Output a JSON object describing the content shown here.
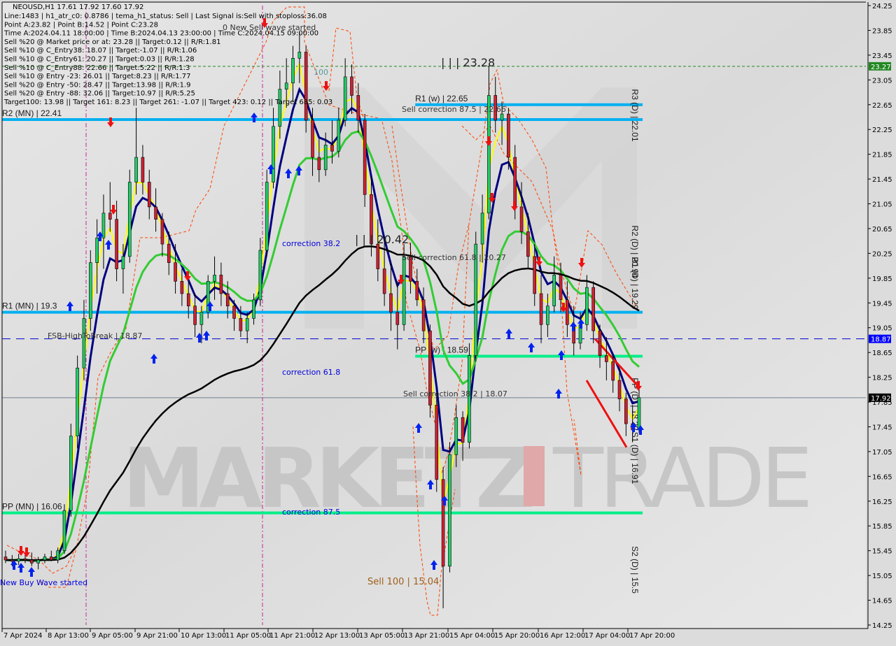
{
  "window": {
    "symbol_header": "NEOUSD,H1  17.61 17.92 17.60 17.92"
  },
  "info_lines": [
    "Line:1483 | h1_atr_c0: 0.8786 | tema_h1_status: Sell | Last Signal is:Sell with stoploss:36.08",
    "Point A:23.82 | Point B:14.52 | Point C:23.28",
    "Time A:2024.04.11 18:00:00 | Time B:2024.04.13 23:00:00 | Time C:2024.04.15 09:00:00",
    "Sell %20 @ Market price or at: 23.28 || Target:0.12 || R/R:1.81",
    "Sell %10 @ C_Entry38: 18.07 || Target:-1.07 || R/R:1.06",
    "Sell %10 @ C_Entry61: 20.27 || Target:0.03 || R/R:1.28",
    "Sell %10 @ C_Entry88: 22.66 || Target:5.22 || R/R:1.3",
    "Sell %10 @ Entry -23: 26.01 || Target:8.23 || R/R:1.77",
    "Sell %20 @ Entry -50: 28.47 || Target:13.98 || R/R:1.9",
    "Sell %20 @ Entry -88: 32.06 || Target:10.97 || R/R:5.25",
    "Target100: 13.98 || Target 161: 8.23 || Target 261: -1.07 || Target 423: 0.12 || Target 685: 0.03"
  ],
  "watermark": {
    "left": "MARKETZ",
    "right": "TRADE"
  },
  "colors": {
    "bull": "#22cc66",
    "bear": "#cc2233",
    "pivot_cyan": "#00b0f0",
    "pivot_green": "#00ee88",
    "ema_yellow": "#ffff00",
    "ema_navy": "#000080",
    "ema_green": "#33cc33",
    "ema_black": "#000000",
    "envelope": "#ff4400",
    "price_tag_green": "#228822",
    "price_tag_blue": "#0000ff",
    "price_tag_black": "#000000"
  },
  "chart_data": {
    "type": "candlestick",
    "title": "NEOUSD,H1",
    "ylim": [
      14.25,
      24.25
    ],
    "y_ticks": [
      "24.25",
      "23.85",
      "23.45",
      "23.05",
      "22.65",
      "22.25",
      "21.85",
      "21.45",
      "21.05",
      "20.65",
      "20.25",
      "19.85",
      "19.45",
      "19.05",
      "18.65",
      "18.25",
      "17.85",
      "17.45",
      "17.05",
      "16.65",
      "16.25",
      "15.85",
      "15.45",
      "15.05",
      "14.65",
      "14.25"
    ],
    "x_ticks": [
      "7 Apr 2024",
      "8 Apr 13:00",
      "9 Apr 05:00",
      "9 Apr 21:00",
      "10 Apr 13:00",
      "11 Apr 05:00",
      "11 Apr 21:00",
      "12 Apr 13:00",
      "13 Apr 05:00",
      "13 Apr 21:00",
      "15 Apr 04:00",
      "15 Apr 20:00",
      "16 Apr 12:00",
      "17 Apr 04:00",
      "17 Apr 20:00"
    ],
    "price_tags": [
      {
        "value": "23.27",
        "price": 23.27,
        "style": "green"
      },
      {
        "value": "18.87",
        "price": 18.87,
        "style": "blue"
      },
      {
        "value": "17.92",
        "price": 17.92,
        "style": "black"
      }
    ],
    "levels": [
      {
        "label": "R2 (MN) | 22.41",
        "price": 22.41,
        "color": "cyan",
        "x_start": 0.0,
        "x_end": 1.0
      },
      {
        "label": "R1 (MN) | 19.3",
        "price": 19.3,
        "color": "cyan",
        "x_start": 0.0,
        "x_end": 1.0
      },
      {
        "label": "PP (MN) | 16.06",
        "price": 16.06,
        "color": "green",
        "x_start": 0.0,
        "x_end": 1.0
      },
      {
        "label": "R1 (w) | 22.65",
        "price": 22.65,
        "color": "cyan",
        "x_start": 0.645,
        "x_end": 1.0
      },
      {
        "label": "PP (w) | 18.59",
        "price": 18.59,
        "color": "green",
        "x_start": 0.645,
        "x_end": 1.0
      }
    ],
    "daily_pivots": [
      {
        "label": "R3 (D) | 22.01",
        "price": 22.01
      },
      {
        "label": "R2 (D) | 20.94",
        "price": 20.94
      },
      {
        "label": "R1 (D) | 19.29",
        "price": 19.29
      },
      {
        "label": "PP (D) | 18.22",
        "price": 18.22
      },
      {
        "label": "S1 (D) | 16.91",
        "price": 16.91
      },
      {
        "label": "S2 (D) | 15.5",
        "price": 15.5
      }
    ],
    "annotations": [
      {
        "text": "0 New Sell wave started",
        "type": "gray"
      },
      {
        "text": "| | | 23.28",
        "type": "gray"
      },
      {
        "text": "Sell correction 87.5 | 22.66",
        "type": "gray"
      },
      {
        "text": "correction 38.2",
        "type": "blue"
      },
      {
        "text": "| | | 20.42",
        "type": "gray"
      },
      {
        "text": "Sell correction 61.8 | 20.27",
        "type": "gray"
      },
      {
        "text": "FSB-HighToBreak | 18.87",
        "type": "gray"
      },
      {
        "text": "correction 61.8",
        "type": "blue"
      },
      {
        "text": "Sell correction 38.2 | 18.07",
        "type": "gray"
      },
      {
        "text": "correction 87.5",
        "type": "blue"
      },
      {
        "text": "Sell 100 | 15.04",
        "type": "brown"
      },
      {
        "text": "New Buy Wave started",
        "type": "blue"
      },
      {
        "text": "100",
        "type": "teal"
      }
    ],
    "candles": [
      [
        15.35,
        15.45,
        15.25,
        15.3
      ],
      [
        15.3,
        15.38,
        15.2,
        15.28
      ],
      [
        15.28,
        15.4,
        15.22,
        15.32
      ],
      [
        15.32,
        15.4,
        15.25,
        15.3
      ],
      [
        15.3,
        15.42,
        15.2,
        15.25
      ],
      [
        15.25,
        15.35,
        15.15,
        15.3
      ],
      [
        15.3,
        15.4,
        15.25,
        15.35
      ],
      [
        15.35,
        15.45,
        15.28,
        15.3
      ],
      [
        15.3,
        15.5,
        15.25,
        15.45
      ],
      [
        15.45,
        16.2,
        15.4,
        16.1
      ],
      [
        16.1,
        17.5,
        16.0,
        17.3
      ],
      [
        17.3,
        18.6,
        17.1,
        18.4
      ],
      [
        18.4,
        19.5,
        18.2,
        19.2
      ],
      [
        19.2,
        20.3,
        19.0,
        20.1
      ],
      [
        20.1,
        20.8,
        19.6,
        20.5
      ],
      [
        20.5,
        21.2,
        20.0,
        20.9
      ],
      [
        20.9,
        21.4,
        20.6,
        20.8
      ],
      [
        20.8,
        21.1,
        19.8,
        20.0
      ],
      [
        20.0,
        20.4,
        19.6,
        20.2
      ],
      [
        20.2,
        21.6,
        20.1,
        21.4
      ],
      [
        21.4,
        22.6,
        21.2,
        21.8
      ],
      [
        21.8,
        22.0,
        21.2,
        21.4
      ],
      [
        21.4,
        21.6,
        20.8,
        21.0
      ],
      [
        21.0,
        21.3,
        20.6,
        20.8
      ],
      [
        20.8,
        20.9,
        20.2,
        20.4
      ],
      [
        20.4,
        20.6,
        19.9,
        20.1
      ],
      [
        20.1,
        20.4,
        19.6,
        19.8
      ],
      [
        19.8,
        20.0,
        19.4,
        19.6
      ],
      [
        19.6,
        19.8,
        19.2,
        19.4
      ],
      [
        19.4,
        19.6,
        18.9,
        19.1
      ],
      [
        19.1,
        19.4,
        18.8,
        19.3
      ],
      [
        19.3,
        19.9,
        19.2,
        19.8
      ],
      [
        19.8,
        20.2,
        19.5,
        19.9
      ],
      [
        19.9,
        20.1,
        19.4,
        19.6
      ],
      [
        19.6,
        19.8,
        19.2,
        19.4
      ],
      [
        19.4,
        19.5,
        19.0,
        19.2
      ],
      [
        19.2,
        19.4,
        18.9,
        19.0
      ],
      [
        19.0,
        19.3,
        18.8,
        19.2
      ],
      [
        19.2,
        19.6,
        19.1,
        19.5
      ],
      [
        19.5,
        20.5,
        19.4,
        20.3
      ],
      [
        20.3,
        21.6,
        20.2,
        21.4
      ],
      [
        21.4,
        22.6,
        21.3,
        22.3
      ],
      [
        22.3,
        23.2,
        22.1,
        22.9
      ],
      [
        22.9,
        23.4,
        22.6,
        23.0
      ],
      [
        23.0,
        23.6,
        22.7,
        23.4
      ],
      [
        23.4,
        23.82,
        23.0,
        23.5
      ],
      [
        23.5,
        23.6,
        22.2,
        22.4
      ],
      [
        22.4,
        22.6,
        21.5,
        21.8
      ],
      [
        21.8,
        22.1,
        21.4,
        21.6
      ],
      [
        21.6,
        22.2,
        21.5,
        22.0
      ],
      [
        22.0,
        22.4,
        21.7,
        21.9
      ],
      [
        21.9,
        22.6,
        21.8,
        22.4
      ],
      [
        22.4,
        23.4,
        22.3,
        23.1
      ],
      [
        23.1,
        23.3,
        22.5,
        22.8
      ],
      [
        22.8,
        23.0,
        22.2,
        22.4
      ],
      [
        22.4,
        22.5,
        21.0,
        21.2
      ],
      [
        21.2,
        21.5,
        20.2,
        20.4
      ],
      [
        20.4,
        20.8,
        19.8,
        20.0
      ],
      [
        20.0,
        20.5,
        19.4,
        19.6
      ],
      [
        19.6,
        20.1,
        19.0,
        19.3
      ],
      [
        19.3,
        19.8,
        18.7,
        19.1
      ],
      [
        19.1,
        20.4,
        19.0,
        20.2
      ],
      [
        20.2,
        20.42,
        19.6,
        19.8
      ],
      [
        19.8,
        20.0,
        19.4,
        19.5
      ],
      [
        19.5,
        19.7,
        18.8,
        19.0
      ],
      [
        19.0,
        19.1,
        17.6,
        17.8
      ],
      [
        17.8,
        18.0,
        16.4,
        16.6
      ],
      [
        16.6,
        16.8,
        14.52,
        15.2
      ],
      [
        15.2,
        17.2,
        15.1,
        17.0
      ],
      [
        17.0,
        17.8,
        16.8,
        17.6
      ],
      [
        17.6,
        17.7,
        16.9,
        17.2
      ],
      [
        17.2,
        18.8,
        17.1,
        18.6
      ],
      [
        18.6,
        20.6,
        18.5,
        20.4
      ],
      [
        20.4,
        21.2,
        20.1,
        20.9
      ],
      [
        20.9,
        23.28,
        20.8,
        22.8
      ],
      [
        22.8,
        23.1,
        22.2,
        22.4
      ],
      [
        22.4,
        22.7,
        22.0,
        22.5
      ],
      [
        22.5,
        22.6,
        21.6,
        21.8
      ],
      [
        21.8,
        22.0,
        20.8,
        21.0
      ],
      [
        21.0,
        21.4,
        20.4,
        20.6
      ],
      [
        20.6,
        20.9,
        20.0,
        20.2
      ],
      [
        20.2,
        20.4,
        19.4,
        19.6
      ],
      [
        19.6,
        19.9,
        18.8,
        19.1
      ],
      [
        19.1,
        19.6,
        18.9,
        19.4
      ],
      [
        19.4,
        20.2,
        19.3,
        19.9
      ],
      [
        19.9,
        20.1,
        19.3,
        19.5
      ],
      [
        19.5,
        19.8,
        18.9,
        19.1
      ],
      [
        19.1,
        19.4,
        18.6,
        18.8
      ],
      [
        18.8,
        19.3,
        18.7,
        19.1
      ],
      [
        19.1,
        19.9,
        19.0,
        19.7
      ],
      [
        19.7,
        19.8,
        18.8,
        19.0
      ],
      [
        19.0,
        19.1,
        18.4,
        18.6
      ],
      [
        18.6,
        18.9,
        18.2,
        18.5
      ],
      [
        18.5,
        18.6,
        18.0,
        18.2
      ],
      [
        18.2,
        18.4,
        17.7,
        17.9
      ],
      [
        17.9,
        18.0,
        17.3,
        17.5
      ],
      [
        17.5,
        17.8,
        17.2,
        17.4
      ],
      [
        17.4,
        18.1,
        17.35,
        17.92
      ]
    ]
  }
}
